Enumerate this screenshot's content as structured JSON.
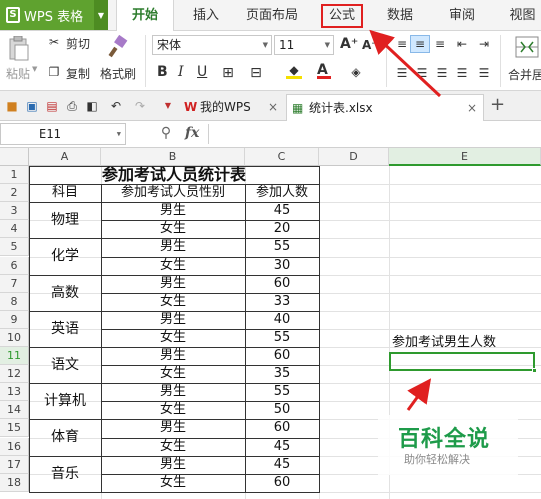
{
  "app": {
    "wps_label": "WPS 表格",
    "tabs": [
      {
        "label": "开始"
      },
      {
        "label": "插入"
      },
      {
        "label": "页面布局"
      },
      {
        "label": "公式"
      },
      {
        "label": "数据"
      },
      {
        "label": "审阅"
      },
      {
        "label": "视图"
      }
    ]
  },
  "ribbon": {
    "paste": "粘贴",
    "cut": "剪切",
    "copy": "复制",
    "format_painter": "格式刷",
    "font_name": "宋体",
    "font_size": "11",
    "bold": "B",
    "italic": "I",
    "underline": "U",
    "font_color_label": "A",
    "grow_font": "A⁺",
    "shrink_font": "A⁻",
    "merge_center": "合并居"
  },
  "docbar": {
    "tabs": [
      {
        "label": "我的WPS",
        "close": "×"
      },
      {
        "label": "统计表.xlsx",
        "close": "×"
      }
    ],
    "add": "+"
  },
  "formula_bar": {
    "cell_ref": "E11",
    "fx": "fx",
    "value": ""
  },
  "sheet": {
    "columns": [
      "A",
      "B",
      "C",
      "D",
      "E"
    ],
    "rows": [
      "1",
      "2",
      "3",
      "4",
      "5",
      "6",
      "7",
      "8",
      "9",
      "10",
      "11",
      "12",
      "13",
      "14",
      "15",
      "16",
      "17",
      "18"
    ],
    "title": "参加考试人员统计表",
    "headers": [
      "科目",
      "参加考试人员性别",
      "参加人数"
    ],
    "subjects": [
      "物理",
      "化学",
      "高数",
      "英语",
      "语文",
      "计算机",
      "体育",
      "音乐"
    ],
    "genders": [
      "男生",
      "女生",
      "男生",
      "女生",
      "男生",
      "女生",
      "男生",
      "女生",
      "男生",
      "女生",
      "男生",
      "女生",
      "男生",
      "女生",
      "男生",
      "女生"
    ],
    "counts": [
      "45",
      "20",
      "55",
      "30",
      "60",
      "33",
      "40",
      "55",
      "60",
      "35",
      "55",
      "50",
      "60",
      "45",
      "45",
      "60"
    ],
    "e10_label": "参加考试男生人数",
    "e11_value": ""
  },
  "watermark": {
    "title": "百科全说",
    "subtitle": "助你轻松解决"
  },
  "colors": {
    "wps_green": "#5fa22f",
    "annotation_red": "#e02020",
    "selection_green": "#2e9a2e"
  }
}
